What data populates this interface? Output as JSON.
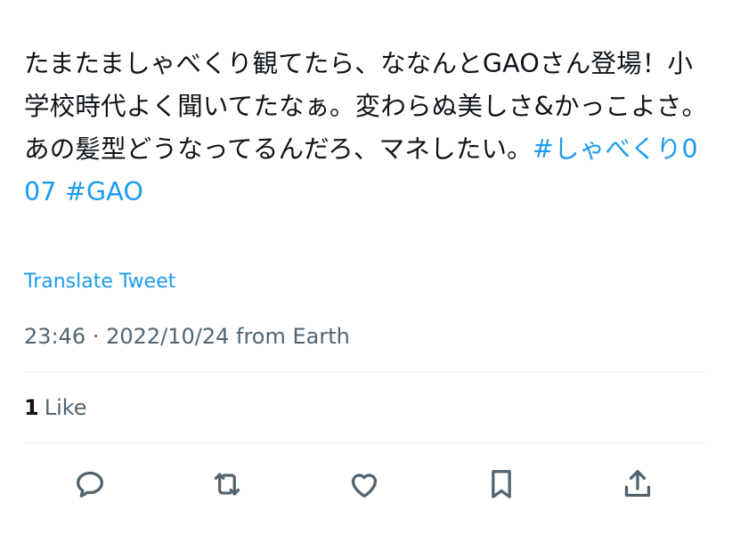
{
  "tweet": {
    "text_line_1": "たまたましゃべくり観てたら、ななんとGAOさん登",
    "text_line_2": "場！小学校時代よく聞いてたなぁ。変わらぬ美しさ&",
    "text_line_3": "かっこよさ。あの髪型どうなってるんだろ、マネした",
    "text_line_4": "い。",
    "hashtags": [
      "#しゃべくり007",
      "#GAO"
    ]
  },
  "translate_label": "Translate Tweet",
  "meta": {
    "time": "23:46",
    "separator": " · ",
    "date": "2022/10/24",
    "source": " from Earth"
  },
  "stats": {
    "likes_count": "1",
    "likes_label": "Like"
  },
  "actions": {
    "icons": [
      "reply-icon",
      "retweet-icon",
      "like-icon",
      "bookmark-icon",
      "share-icon"
    ]
  },
  "colors": {
    "text": "#0f1419",
    "secondary": "#536471",
    "link": "#1d9bf0",
    "divider": "#eff3f4"
  }
}
